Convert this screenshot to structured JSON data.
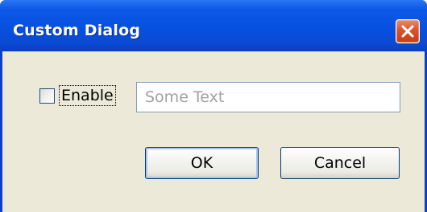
{
  "window": {
    "title": "Custom Dialog",
    "close_icon": "close-icon",
    "title_color": "#ffffff",
    "titlebar_color": "#0751e0",
    "client_color": "#ece9d8"
  },
  "form": {
    "enable_checkbox": {
      "label": "Enable",
      "checked": false
    },
    "text_field": {
      "value": "",
      "placeholder": "Some Text"
    }
  },
  "buttons": {
    "ok_label": "OK",
    "cancel_label": "Cancel"
  }
}
